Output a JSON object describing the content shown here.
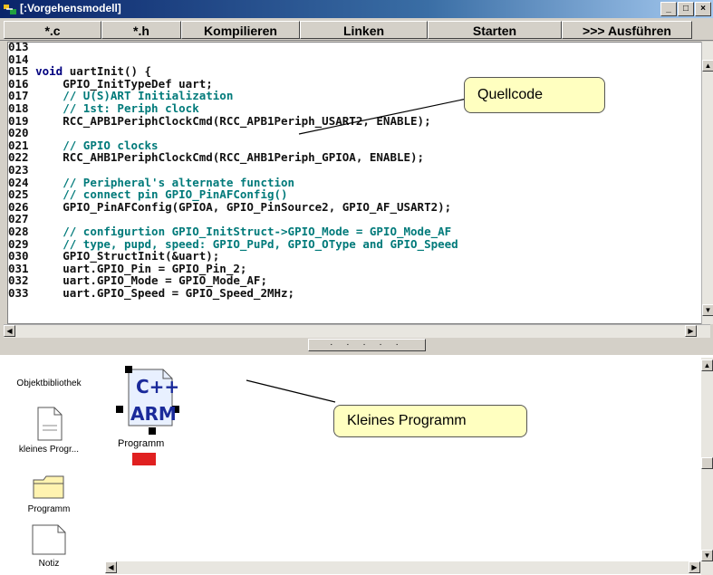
{
  "window": {
    "title": "[:Vorgehensmodell]",
    "min": "_",
    "max": "□",
    "close": "×"
  },
  "toolbar": {
    "buttons": [
      "*.c",
      "*.h",
      "Kompilieren",
      "Linken",
      "Starten",
      ">>> Ausführen"
    ]
  },
  "editor": {
    "lines": [
      {
        "n": "013",
        "code": ""
      },
      {
        "n": "014",
        "code": ""
      },
      {
        "n": "015",
        "code": "void uartInit() {"
      },
      {
        "n": "016",
        "code": "    GPIO_InitTypeDef uart;"
      },
      {
        "n": "017",
        "code": "    // U(S)ART Initialization"
      },
      {
        "n": "018",
        "code": "    // 1st: Periph clock"
      },
      {
        "n": "019",
        "code": "    RCC_APB1PeriphClockCmd(RCC_APB1Periph_USART2, ENABLE);"
      },
      {
        "n": "020",
        "code": ""
      },
      {
        "n": "021",
        "code": "    // GPIO clocks"
      },
      {
        "n": "022",
        "code": "    RCC_AHB1PeriphClockCmd(RCC_AHB1Periph_GPIOA, ENABLE);"
      },
      {
        "n": "023",
        "code": ""
      },
      {
        "n": "024",
        "code": "    // Peripheral's alternate function"
      },
      {
        "n": "025",
        "code": "    // connect pin GPIO_PinAFConfig()"
      },
      {
        "n": "026",
        "code": "    GPIO_PinAFConfig(GPIOA, GPIO_PinSource2, GPIO_AF_USART2);"
      },
      {
        "n": "027",
        "code": ""
      },
      {
        "n": "028",
        "code": "    // configurtion GPIO_InitStruct->GPIO_Mode = GPIO_Mode_AF"
      },
      {
        "n": "029",
        "code": "    // type, pupd, speed: GPIO_PuPd, GPIO_OType and GPIO_Speed"
      },
      {
        "n": "030",
        "code": "    GPIO_StructInit(&uart);"
      },
      {
        "n": "031",
        "code": "    uart.GPIO_Pin = GPIO_Pin_2;"
      },
      {
        "n": "032",
        "code": "    uart.GPIO_Mode = GPIO_Mode_AF;"
      },
      {
        "n": "033",
        "code": "    uart.GPIO_Speed = GPIO_Speed_2MHz;"
      }
    ]
  },
  "splitter": {
    "label": "· · · · ·"
  },
  "palette": {
    "items": [
      {
        "label": "Objektbibliothek"
      },
      {
        "label": "kleines Progr..."
      },
      {
        "label": "Programm"
      },
      {
        "label": "Notiz"
      }
    ]
  },
  "canvas": {
    "node": {
      "label": "Programm",
      "icon_top": "C++",
      "icon_bottom": "ARM"
    }
  },
  "callouts": {
    "quellcode": "Quellcode",
    "programm": "Kleines Programm"
  },
  "colors": {
    "titlebar": "#0a246a",
    "callout": "#ffffc0",
    "comment": "#007a7a",
    "keyword": "#00007f",
    "node_marker": "#e02020"
  }
}
